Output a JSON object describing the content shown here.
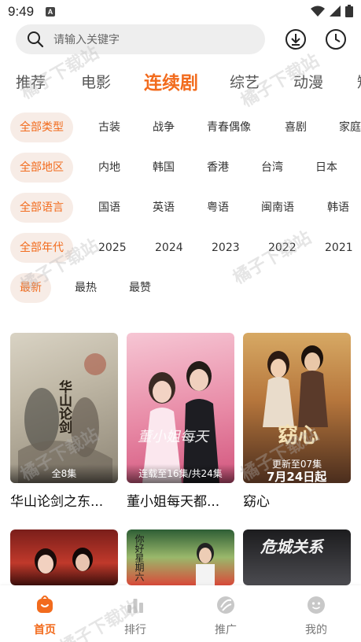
{
  "status_bar": {
    "time": "9:49",
    "notif_letter": "A"
  },
  "search": {
    "placeholder": "请输入关键字"
  },
  "category_tabs": [
    {
      "label": "推荐",
      "active": false
    },
    {
      "label": "电影",
      "active": false
    },
    {
      "label": "连续剧",
      "active": true
    },
    {
      "label": "综艺",
      "active": false
    },
    {
      "label": "动漫",
      "active": false
    },
    {
      "label": "短",
      "active": false
    }
  ],
  "filters": {
    "type": [
      "全部类型",
      "古装",
      "战争",
      "青春偶像",
      "喜剧",
      "家庭"
    ],
    "region": [
      "全部地区",
      "内地",
      "韩国",
      "香港",
      "台湾",
      "日本"
    ],
    "language": [
      "全部语言",
      "国语",
      "英语",
      "粤语",
      "闽南语",
      "韩语"
    ],
    "year": [
      "全部年代",
      "2025",
      "2024",
      "2023",
      "2022",
      "2021"
    ],
    "sort": [
      "最新",
      "最热",
      "最赞"
    ]
  },
  "shows": [
    {
      "title": "华山论剑之东...",
      "badge": "全8集",
      "poster_text": "华山论剑"
    },
    {
      "title": "董小姐每天都...",
      "badge": "连载至16集/共24集",
      "poster_text": "董小姐每天"
    },
    {
      "title": "窈心",
      "badge": "更新至07集",
      "poster_text": "窈心",
      "poster_date": "7月24日起"
    }
  ],
  "more_shows": [
    {
      "poster_text": ""
    },
    {
      "poster_text": "你好星期六"
    },
    {
      "poster_text": "危城关系"
    }
  ],
  "bottom_nav": [
    {
      "label": "首页",
      "active": true,
      "icon": "home-icon"
    },
    {
      "label": "排行",
      "active": false,
      "icon": "ranking-icon"
    },
    {
      "label": "推广",
      "active": false,
      "icon": "promote-icon"
    },
    {
      "label": "我的",
      "active": false,
      "icon": "profile-icon"
    }
  ],
  "watermark": "橘子下载站",
  "colors": {
    "accent": "#f26b1d",
    "chip_bg": "#f7ece6",
    "search_bg": "#eeeeee"
  }
}
